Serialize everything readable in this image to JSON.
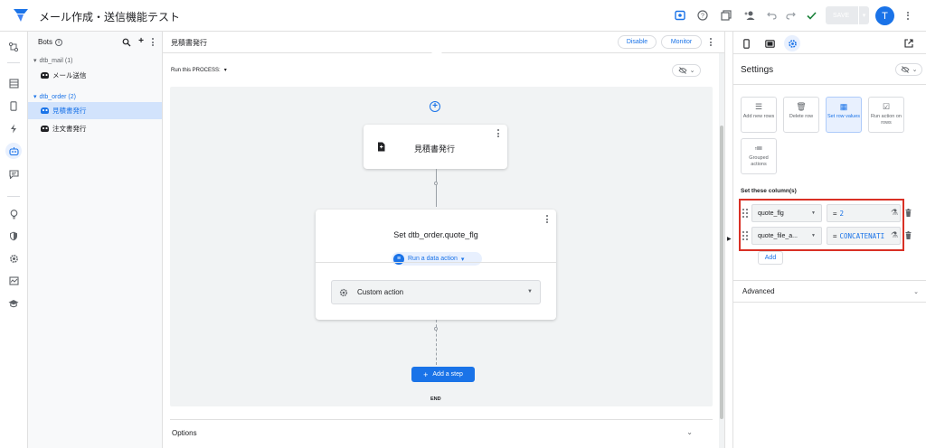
{
  "app": {
    "title": "メール作成・送信機能テスト",
    "accent": "#1a73e8",
    "highlight": "#d93025"
  },
  "topbar": {
    "save_label": "SAVE",
    "avatar_letter": "T"
  },
  "bots": {
    "title": "Bots",
    "groups": [
      {
        "label": "dtb_mail (1)",
        "items": [
          "メール送信"
        ]
      },
      {
        "label": "dtb_order (2)",
        "items": [
          "見積書発行",
          "注文書発行"
        ]
      }
    ]
  },
  "canvas": {
    "bot_name": "見積書発行",
    "disable_label": "Disable",
    "monitor_label": "Monitor",
    "run_label": "Run this PROCESS:",
    "event_node": "見積書発行",
    "step_title": "Set dtb_order.quote_flg",
    "step_type": "Run a data action",
    "action_select": "Custom action",
    "add_step_label": "Add a step",
    "end_label": "END",
    "options_label": "Options"
  },
  "settings": {
    "title": "Settings",
    "tiles": [
      {
        "label": "Add new rows",
        "icon": "add-rows-icon"
      },
      {
        "label": "Delete row",
        "icon": "trash-icon"
      },
      {
        "label": "Set row values",
        "icon": "table-icon"
      },
      {
        "label": "Run action on rows",
        "icon": "checklist-icon"
      },
      {
        "label": "Grouped actions",
        "icon": "list-icon"
      }
    ],
    "set_columns_label": "Set these column(s)",
    "columns": [
      {
        "column": "quote_flg",
        "expression": "2"
      },
      {
        "column": "quote_file_a...",
        "expression": "CONCATENATI"
      }
    ],
    "add_label": "Add",
    "advanced_label": "Advanced"
  }
}
